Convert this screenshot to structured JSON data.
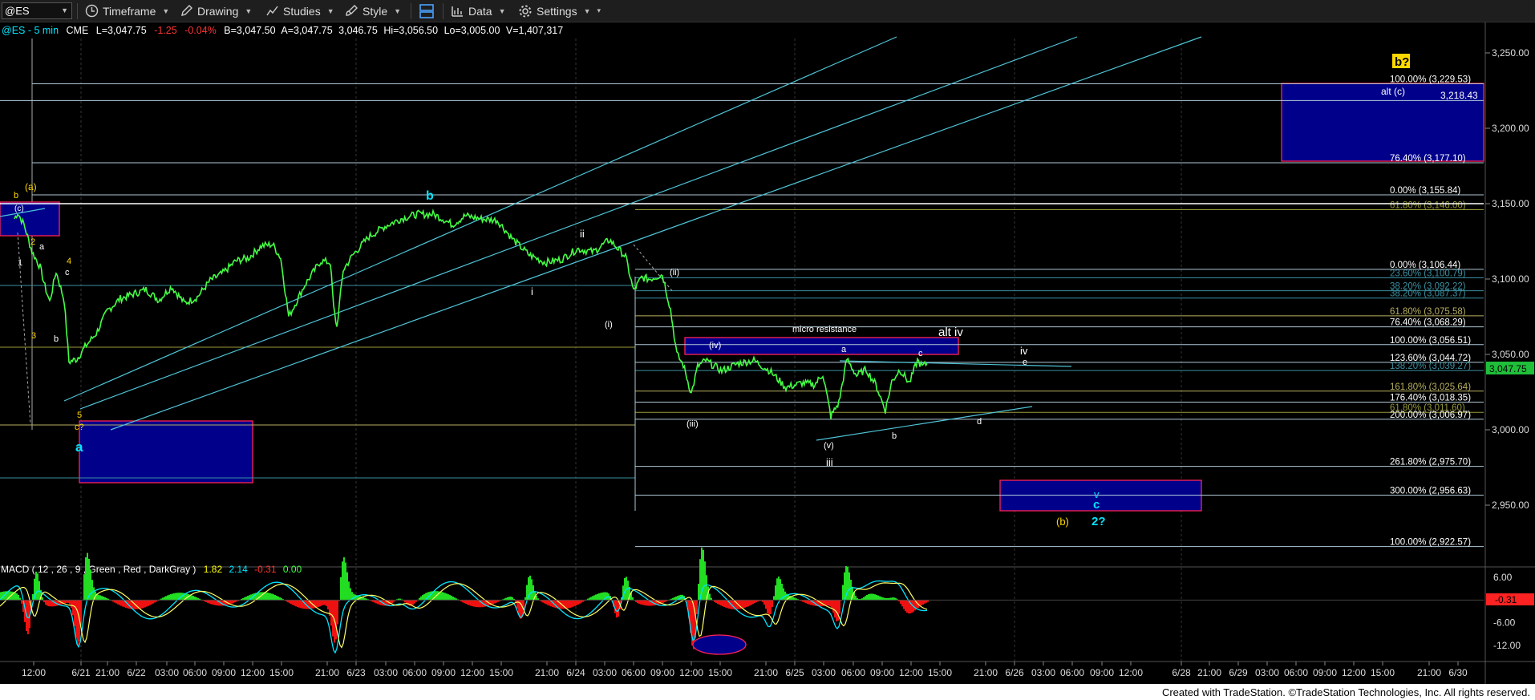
{
  "toolbar": {
    "symbol": "@ES",
    "timeframe": "Timeframe",
    "drawing": "Drawing",
    "studies": "Studies",
    "style": "Style",
    "data": "Data",
    "settings": "Settings"
  },
  "header": {
    "symbol": "@ES - 5 min",
    "exchange": "CME",
    "last": "L=3,047.75",
    "change": "-1.25",
    "change_pct": "-0.04%",
    "bid": "B=3,047.50",
    "ask": "A=3,047.75",
    "open": "3,046.75",
    "high": "Hi=3,056.50",
    "low": "Lo=3,005.00",
    "volume": "V=1,407,317"
  },
  "price_axis": {
    "ticks": [
      {
        "v": 3250,
        "t": "3,250.00"
      },
      {
        "v": 3200,
        "t": "3,200.00"
      },
      {
        "v": 3150,
        "t": "3,150.00"
      },
      {
        "v": 3100,
        "t": "3,100.00"
      },
      {
        "v": 3050,
        "t": "3,050.00"
      },
      {
        "v": 3000,
        "t": "3,000.00"
      },
      {
        "v": 2950,
        "t": "2,950.00"
      }
    ],
    "last_price": "3,047.75",
    "min": 2918,
    "max": 3262
  },
  "macd": {
    "label": "MACD ( 12 , 26 , 9 , Green , Red , DarkGray )",
    "v1": "1.82",
    "v2": "2.14",
    "v3": "-0.31",
    "v4": "0.00",
    "ticks": [
      {
        "v": 6,
        "t": "6.00"
      },
      {
        "v": -6,
        "t": "-6.00"
      },
      {
        "v": -12,
        "t": "-12.00"
      }
    ],
    "last": "-0.31",
    "min": -14.5,
    "max": 7.5
  },
  "time_axis": [
    {
      "x": 42,
      "t": "12:00"
    },
    {
      "x": 101,
      "t": "6/21"
    },
    {
      "x": 134,
      "t": "21:00"
    },
    {
      "x": 170,
      "t": "6/22"
    },
    {
      "x": 208,
      "t": "03:00"
    },
    {
      "x": 243,
      "t": "06:00"
    },
    {
      "x": 279,
      "t": "09:00"
    },
    {
      "x": 315,
      "t": "12:00"
    },
    {
      "x": 351,
      "t": "15:00"
    },
    {
      "x": 408,
      "t": "21:00"
    },
    {
      "x": 444,
      "t": "6/23"
    },
    {
      "x": 481,
      "t": "03:00"
    },
    {
      "x": 517,
      "t": "06:00"
    },
    {
      "x": 553,
      "t": "09:00"
    },
    {
      "x": 589,
      "t": "12:00"
    },
    {
      "x": 625,
      "t": "15:00"
    },
    {
      "x": 682,
      "t": "21:00"
    },
    {
      "x": 718,
      "t": "6/24"
    },
    {
      "x": 754,
      "t": "03:00"
    },
    {
      "x": 790,
      "t": "06:00"
    },
    {
      "x": 826,
      "t": "09:00"
    },
    {
      "x": 862,
      "t": "12:00"
    },
    {
      "x": 898,
      "t": "15:00"
    },
    {
      "x": 955,
      "t": "21:00"
    },
    {
      "x": 991,
      "t": "6/25"
    },
    {
      "x": 1027,
      "t": "03:00"
    },
    {
      "x": 1064,
      "t": "06:00"
    },
    {
      "x": 1100,
      "t": "09:00"
    },
    {
      "x": 1136,
      "t": "12:00"
    },
    {
      "x": 1172,
      "t": "15:00"
    },
    {
      "x": 1229,
      "t": "21:00"
    },
    {
      "x": 1265,
      "t": "6/26"
    },
    {
      "x": 1301,
      "t": "03:00"
    },
    {
      "x": 1337,
      "t": "06:00"
    },
    {
      "x": 1374,
      "t": "09:00"
    },
    {
      "x": 1410,
      "t": "12:00"
    },
    {
      "x": 1473,
      "t": "6/28"
    },
    {
      "x": 1508,
      "t": "21:00"
    },
    {
      "x": 1544,
      "t": "6/29"
    },
    {
      "x": 1580,
      "t": "03:00"
    },
    {
      "x": 1616,
      "t": "06:00"
    },
    {
      "x": 1652,
      "t": "09:00"
    },
    {
      "x": 1688,
      "t": "12:00"
    },
    {
      "x": 1724,
      "t": "15:00"
    },
    {
      "x": 1782,
      "t": "21:00"
    },
    {
      "x": 1818,
      "t": "6/30"
    }
  ],
  "fib_right": [
    {
      "v": 3229.53,
      "t": "100.00% (3,229.53)"
    },
    {
      "v": 3177.1,
      "t": "76.40% (3,177.10)"
    },
    {
      "v": 3155.84,
      "t": "0.00% (3,155.84)"
    },
    {
      "v": 3146.0,
      "t": "61.80% (3,146.00)",
      "c": "#9b9b3a"
    },
    {
      "v": 3106.44,
      "t": "0.00% (3,106.44)"
    },
    {
      "v": 3100.79,
      "t": "23.60% (3,100.79)",
      "c": "#3a8fa0"
    },
    {
      "v": 3092.22,
      "t": "38.20% (3,092.22)",
      "c": "#3a8fa0"
    },
    {
      "v": 3087.37,
      "t": "38.20% (3,087.37)",
      "c": "#3a8fa0"
    },
    {
      "v": 3075.58,
      "t": "61.80% (3,075.58)",
      "c": "#b8b060"
    },
    {
      "v": 3068.29,
      "t": "76.40% (3,068.29)"
    },
    {
      "v": 3056.51,
      "t": "100.00% (3,056.51)"
    },
    {
      "v": 3044.72,
      "t": "123.60% (3,044.72)"
    },
    {
      "v": 3039.27,
      "t": "138.20% (3,039.27)",
      "c": "#3a8fa0"
    },
    {
      "v": 3025.64,
      "t": "161.80% (3,025.64)",
      "c": "#b8b060"
    },
    {
      "v": 3018.35,
      "t": "176.40% (3,018.35)"
    },
    {
      "v": 3011.6,
      "t": "61.80% (3,011.60)",
      "c": "#9b9b3a"
    },
    {
      "v": 3006.97,
      "t": "200.00% (3,006.97)"
    },
    {
      "v": 2975.7,
      "t": "261.80% (2,975.70)"
    },
    {
      "v": 2956.63,
      "t": "300.00% (2,956.63)"
    },
    {
      "v": 2922.57,
      "t": "100.00% (2,922.57)"
    }
  ],
  "fib_extra_line": "3,218.43",
  "annotations": {
    "b_yellow": "b",
    "a_yellow_paren": "(a)",
    "c_paren_box": "(c)",
    "w1": "1",
    "w2": "2",
    "w3": "3",
    "w4": "4",
    "w5": "5",
    "sub_a": "a",
    "sub_b": "b",
    "sub_c": "c",
    "c_q": "c?",
    "big_a": "a",
    "big_b": "b",
    "ii": "ii",
    "i": "i",
    "paren_i": "(i)",
    "paren_ii": "(ii)",
    "paren_iii": "(iii)",
    "paren_iv": "(iv)",
    "paren_v": "(v)",
    "iii": "iii",
    "micro_res": "micro resistance",
    "alt_iv": "alt iv",
    "iv": "iv",
    "e": "e",
    "d": "d",
    "tri_a": "a",
    "tri_b": "b",
    "tri_c": "c",
    "v": "v",
    "c_big": "c",
    "paren_b": "(b)",
    "two_q": "2?",
    "b_q": "b?",
    "alt_c": "alt (c)"
  },
  "footer": "Created with TradeStation. ©TradeStation Technologies, Inc. All rights reserved.",
  "chart_data": {
    "type": "line",
    "title": "@ES - 5 min",
    "series": [
      {
        "name": "@ES - 5 min",
        "x": [
          18,
          22,
          30,
          40,
          50,
          56,
          62,
          70,
          80,
          86,
          96,
          106,
          120,
          134,
          150,
          166,
          182,
          198,
          214,
          230,
          246,
          262,
          278,
          294,
          310,
          326,
          340,
          350,
          360,
          380,
          400,
          412,
          416,
          420,
          428,
          440,
          460,
          480,
          500,
          520,
          540,
          552,
          564,
          580,
          600,
          620,
          640,
          660,
          680,
          700,
          720,
          740,
          760,
          780,
          790,
          800,
          810,
          826,
          836,
          844,
          852,
          862,
          870,
          880,
          900,
          920,
          940,
          960,
          980,
          1000,
          1016,
          1026,
          1036,
          1046,
          1056,
          1068,
          1080,
          1092,
          1104,
          1112,
          1122,
          1134,
          1144,
          1150,
          1156
        ],
        "y": [
          3140,
          3144,
          3136,
          3118,
          3108,
          3095,
          3085,
          3105,
          3086,
          3045,
          3047,
          3055,
          3064,
          3079,
          3087,
          3090,
          3093,
          3086,
          3095,
          3084,
          3088,
          3099,
          3104,
          3112,
          3114,
          3122,
          3123,
          3114,
          3075,
          3096,
          3112,
          3111,
          3081,
          3068,
          3106,
          3116,
          3128,
          3135,
          3140,
          3143,
          3143,
          3140,
          3136,
          3142,
          3140,
          3139,
          3126,
          3116,
          3111,
          3113,
          3120,
          3118,
          3126,
          3115,
          3092,
          3101,
          3100,
          3103,
          3080,
          3050,
          3043,
          3024,
          3042,
          3046,
          3039,
          3044,
          3046,
          3039,
          3028,
          3031,
          3030,
          3037,
          3009,
          3018,
          3047,
          3036,
          3040,
          3030,
          3013,
          3032,
          3040,
          3031,
          3046,
          3042,
          3044
        ]
      }
    ],
    "ylim": [
      2918,
      3262
    ]
  }
}
